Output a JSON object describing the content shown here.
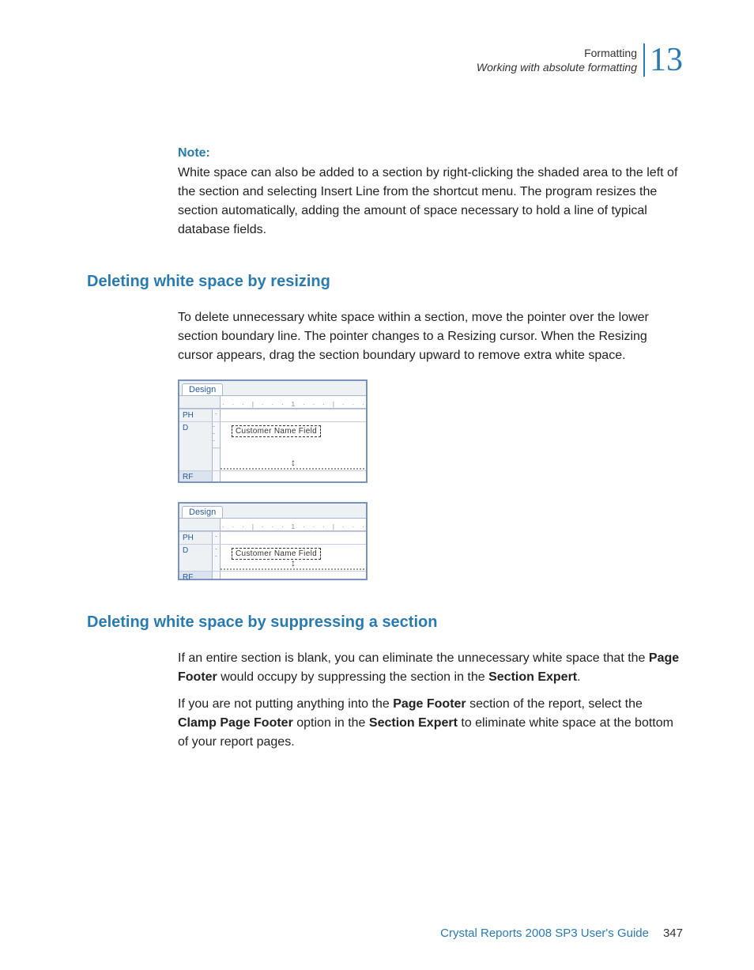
{
  "header": {
    "title": "Formatting",
    "subtitle": "Working with absolute formatting",
    "chapter_number": "13"
  },
  "note": {
    "label": "Note:",
    "body": "White space can also be added to a section by right-clicking the shaded area to the left of the section and selecting Insert Line from the shortcut menu. The program resizes the section automatically, adding the amount of space necessary to hold a line of typical database fields."
  },
  "section1": {
    "heading": "Deleting white space by resizing",
    "body": "To delete unnecessary white space within a section, move the pointer over the lower section boundary line. The pointer changes to a Resizing cursor. When the Resizing cursor appears, drag the section boundary upward to remove extra white space."
  },
  "diagram": {
    "tab": "Design",
    "ruler_num": "1",
    "ph": "PH",
    "d": "D",
    "rf": "RF",
    "field": "Customer Name Field"
  },
  "section2": {
    "heading": "Deleting white space by suppressing a section",
    "p1_a": "If an entire section is blank, you can eliminate the unnecessary white space that the ",
    "p1_b1": "Page Footer",
    "p1_c": " would occupy by suppressing the section in the ",
    "p1_b2": "Section Expert",
    "p1_d": ".",
    "p2_a": "If you are not putting anything into the ",
    "p2_b1": "Page Footer",
    "p2_c": " section of the report, select the ",
    "p2_b2": "Clamp Page Footer",
    "p2_d": " option in the ",
    "p2_b3": "Section Expert",
    "p2_e": " to eliminate white space at the bottom of your report pages."
  },
  "footer": {
    "guide": "Crystal Reports 2008 SP3 User's Guide",
    "page": "347"
  }
}
